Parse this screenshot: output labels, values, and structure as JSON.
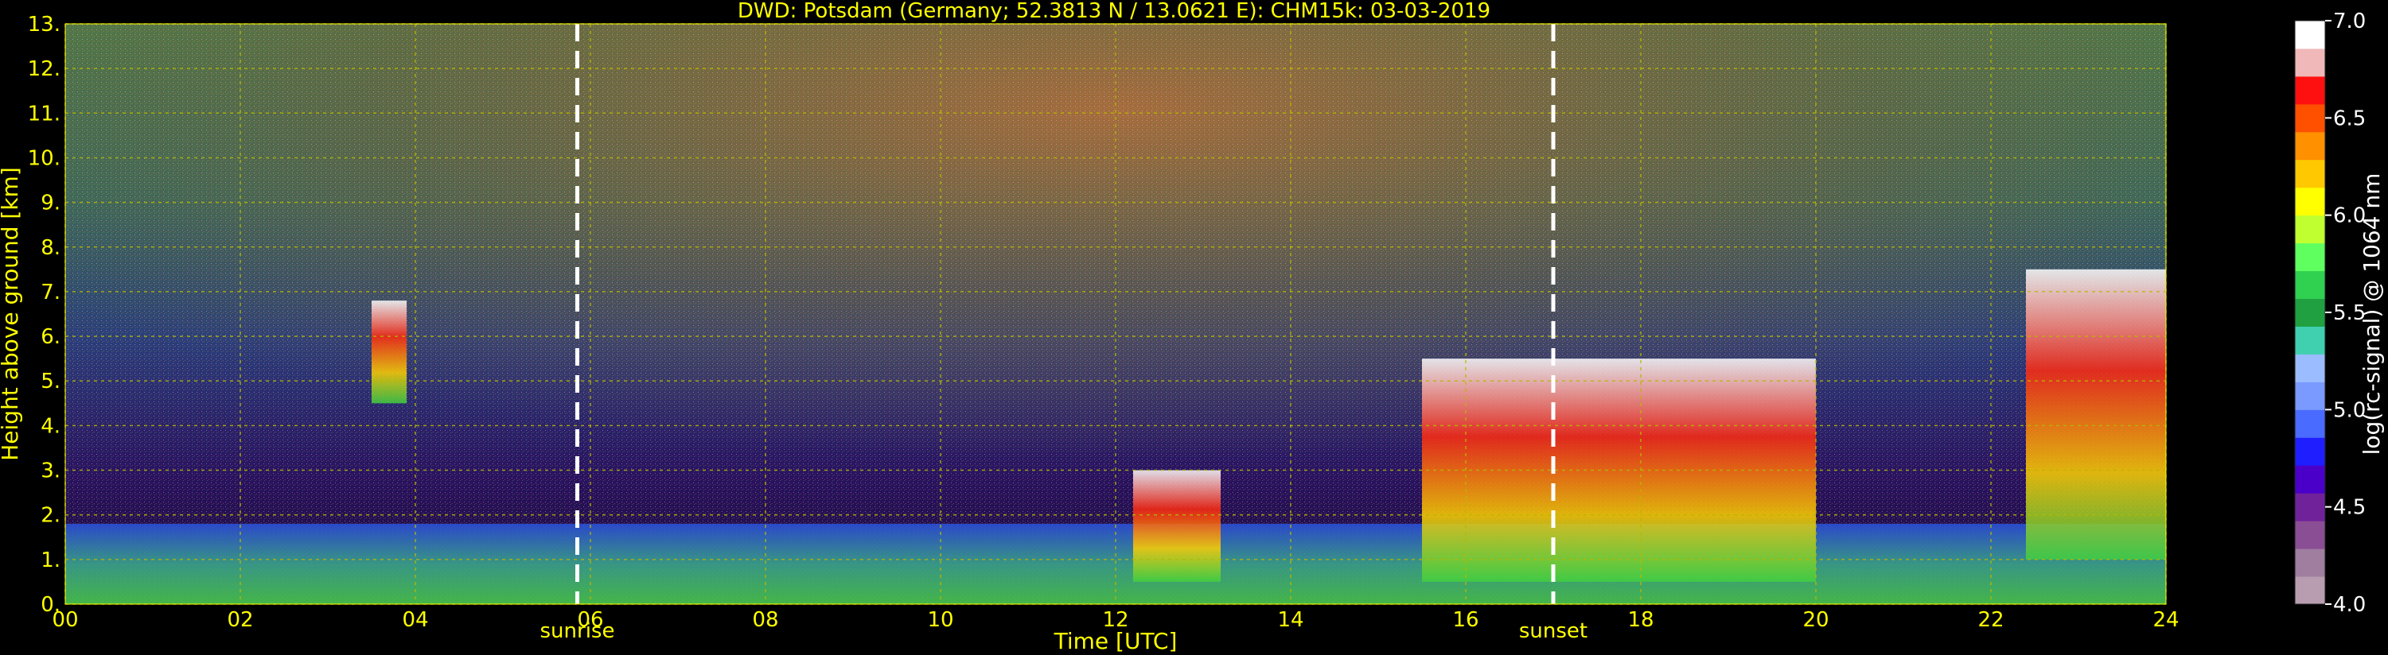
{
  "chart_data": {
    "type": "heatmap",
    "title": "DWD: Potsdam (Germany; 52.3813 N / 13.0621 E):    CHM15k: 03-03-2019",
    "xlabel": "Time [UTC]",
    "ylabel": "Height above ground [km]",
    "x_range": [
      0,
      24
    ],
    "y_range": [
      0,
      13
    ],
    "x_ticks": [
      "00",
      "02",
      "04",
      "06",
      "08",
      "10",
      "12",
      "14",
      "16",
      "18",
      "20",
      "22",
      "24"
    ],
    "y_ticks": [
      "0.",
      "1.",
      "2.",
      "3.",
      "4.",
      "5.",
      "6.",
      "7.",
      "8.",
      "9.",
      "10.",
      "11.",
      "12.",
      "13."
    ],
    "grid": true,
    "markers": [
      {
        "label": "sunrise",
        "x": 5.85
      },
      {
        "label": "sunset",
        "x": 17.0
      }
    ],
    "colorbar": {
      "label": "log(rc-signal) @ 1064 nm",
      "range": [
        4.0,
        7.0
      ],
      "ticks": [
        "4.0",
        "4.5",
        "5.0",
        "5.5",
        "6.0",
        "6.5",
        "7.0"
      ],
      "colors": [
        "#b89db0",
        "#a07ea0",
        "#8a4e94",
        "#70229a",
        "#4a00c8",
        "#1e1eff",
        "#4a6bff",
        "#7a9aff",
        "#9bbcff",
        "#40d0b0",
        "#20a040",
        "#30d050",
        "#60ff60",
        "#c0ff30",
        "#ffff00",
        "#ffc800",
        "#ff9000",
        "#ff5000",
        "#ff1010",
        "#f0b8b8",
        "#ffffff"
      ]
    },
    "features": [
      {
        "name": "boundary layer",
        "x": [
          0,
          24
        ],
        "height_km": [
          0,
          1.8
        ]
      },
      {
        "name": "cloud",
        "x": [
          3.5,
          3.9
        ],
        "height_km": [
          4.5,
          6.8
        ]
      },
      {
        "name": "low cloud",
        "x": [
          12.2,
          13.2
        ],
        "height_km": [
          0.5,
          3.0
        ]
      },
      {
        "name": "cloud",
        "x": [
          15.5,
          20.0
        ],
        "height_km": [
          0.5,
          5.5
        ]
      },
      {
        "name": "cloud",
        "x": [
          22.4,
          24
        ],
        "height_km": [
          1.0,
          7.5
        ]
      }
    ]
  }
}
